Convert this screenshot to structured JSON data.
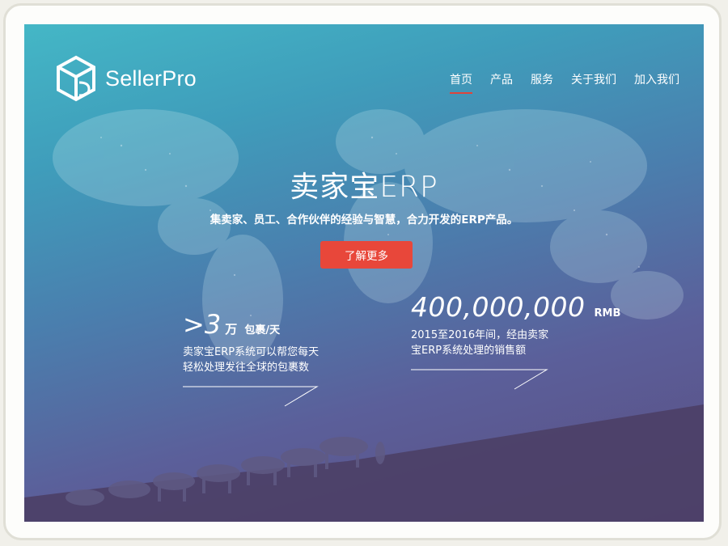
{
  "brand": {
    "name": "SellerPro"
  },
  "nav": {
    "items": [
      {
        "label": "首页",
        "active": true
      },
      {
        "label": "产品",
        "active": false
      },
      {
        "label": "服务",
        "active": false
      },
      {
        "label": "关于我们",
        "active": false
      },
      {
        "label": "加入我们",
        "active": false
      }
    ]
  },
  "hero": {
    "title": "卖家宝ERP",
    "subtitle": "集卖家、员工、合作伙伴的经验与智慧，合力开发的ERP产品。",
    "cta_label": "了解更多"
  },
  "stats": [
    {
      "prefix": ">",
      "value": "3",
      "unit": "万",
      "suffix": "包裹/天",
      "line1": "卖家宝ERP系统可以帮您每天",
      "line2": "轻松处理发往全球的包裹数"
    },
    {
      "value": "400,000,000",
      "unit": "RMB",
      "line1": "2015至2016年间，经由卖家",
      "line2": "宝ERP系统处理的销售额"
    }
  ],
  "colors": {
    "accent": "#e8473a",
    "gradient_top": "#44b7c6",
    "gradient_bottom": "#5a4d80"
  }
}
